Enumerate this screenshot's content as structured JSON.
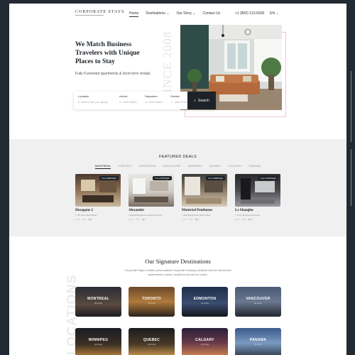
{
  "brand": {
    "logo": "CORPORATE STAYS"
  },
  "nav": {
    "items": [
      "Home",
      "Destinations",
      "Our Story",
      "Contact Us"
    ],
    "phone": "+1 (800) 213-6630",
    "lang": "EN"
  },
  "hero": {
    "title": "We Match Business Travelers with Unique Places to Stay",
    "subtitle": "Fully Furnished apartments & short term rentals",
    "since": "SINCE 2008"
  },
  "search": {
    "location_label": "Location",
    "location_value": "Where are you going",
    "arrival_label": "Arrival",
    "arrival_value": "Add Dates",
    "departure_label": "Departure",
    "departure_value": "Add Dates",
    "guests_label": "Guests",
    "guests_value": "Add Guests",
    "button": "Search"
  },
  "featured": {
    "title": "FEATURED DEALS",
    "tabs": [
      "MONTREAL",
      "TORONTO",
      "EDMONTON",
      "VANCOUVER",
      "WINNIPEG",
      "QUEBEC",
      "CALGARY",
      "PANAMA"
    ],
    "cards": [
      {
        "name": "Hexagone 2",
        "address": "701 Rue Paris Street",
        "price": "From $99/Night",
        "meta": [
          "2",
          "1",
          "1"
        ]
      },
      {
        "name": "Alexander",
        "address": "Boulevard René-Lévesque Ouest",
        "price": "From $79/Night",
        "meta": [
          "2",
          "1",
          "1"
        ]
      },
      {
        "name": "Montréal Penthouse",
        "address": "450 Sherbrooke Street West",
        "price": "From $99/Night",
        "meta": [
          "4",
          "2",
          "2"
        ]
      },
      {
        "name": "Le Shanghu",
        "address": "1770 Jacques Hermaine",
        "price": "From $119/Night",
        "meta": [
          "4",
          "2",
          "2"
        ]
      }
    ]
  },
  "destinations": {
    "title": "Our Signature Destinations",
    "description": "Corporate Stays creates personalized corporate housing solutions with its full-service apartments in prime locations around the world.",
    "watermark": "LOCATIONS",
    "tiles": [
      {
        "name": "MONTREAL",
        "count": "36 Units"
      },
      {
        "name": "TORONTO",
        "count": "24 Units"
      },
      {
        "name": "EDMONTON",
        "count": "12 Units"
      },
      {
        "name": "VANCOUVER",
        "count": "20 Units"
      },
      {
        "name": "WINNIPEG",
        "count": "10 Units"
      },
      {
        "name": "QUEBEC",
        "count": "16 Units"
      },
      {
        "name": "CALGARY",
        "count": "14 Units"
      },
      {
        "name": "PANAMA",
        "count": "8 Units"
      }
    ]
  },
  "colors": {
    "dark": "#1c2228",
    "accent_frame": "#f2c7d1",
    "section_bg": "#f0f0f0",
    "outer_bg": "#222b33"
  }
}
